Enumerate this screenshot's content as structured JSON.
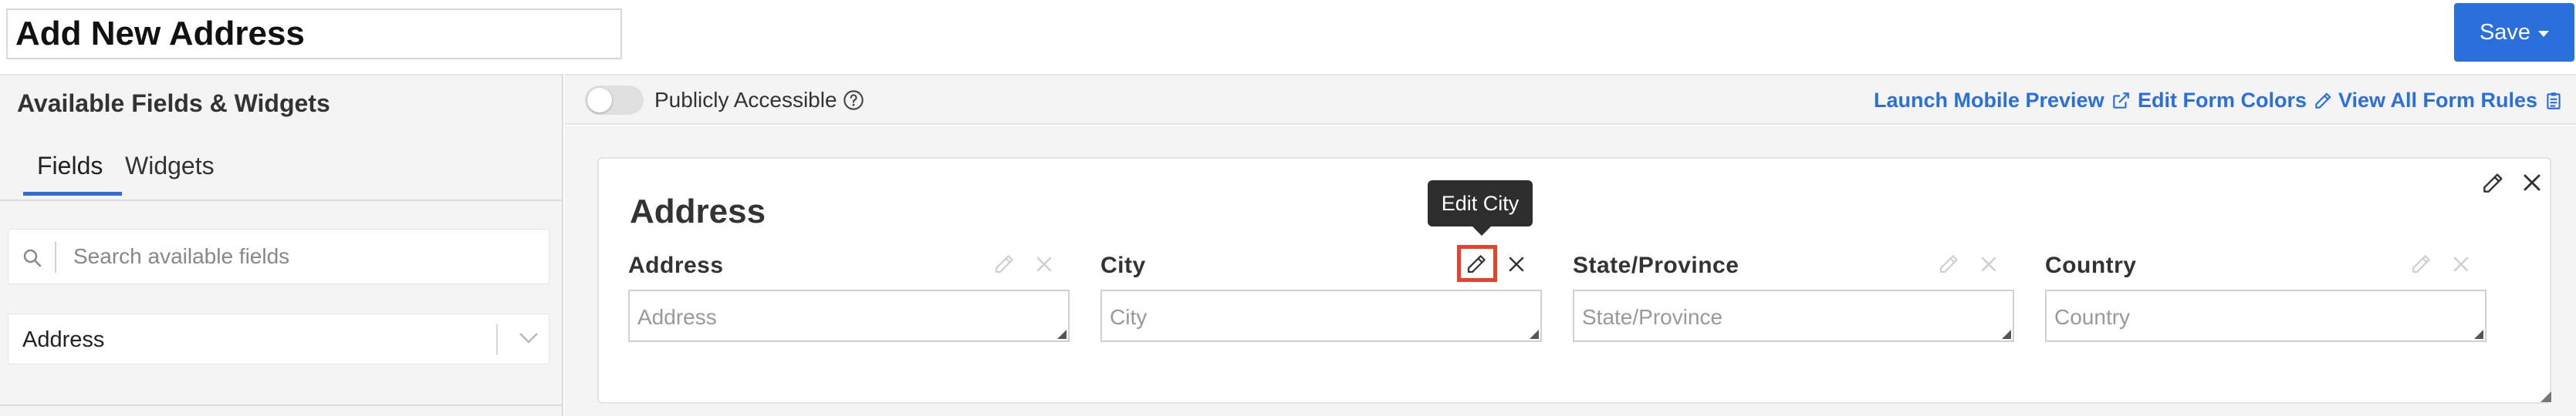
{
  "header": {
    "title": "Add New Address",
    "save_label": "Save"
  },
  "left_panel": {
    "title": "Available Fields & Widgets",
    "tabs": [
      {
        "label": "Fields",
        "active": true
      },
      {
        "label": "Widgets",
        "active": false
      }
    ],
    "search_placeholder": "Search available fields",
    "select_value": "Address"
  },
  "toolbar": {
    "publicly_accessible_label": "Publicly Accessible",
    "publicly_accessible_on": false,
    "links": {
      "mobile_preview": "Launch Mobile Preview",
      "form_colors": "Edit Form Colors",
      "form_rules": "View All Form Rules"
    }
  },
  "card": {
    "title": "Address",
    "fields": [
      {
        "label": "Address",
        "placeholder": "Address"
      },
      {
        "label": "City",
        "placeholder": "City"
      },
      {
        "label": "State/Province",
        "placeholder": "State/Province"
      },
      {
        "label": "Country",
        "placeholder": "Country"
      }
    ]
  },
  "tooltip": "Edit City",
  "colors": {
    "accent": "#2a6fdb",
    "highlight": "#e8412c",
    "panel_bg": "#f4f4f5"
  }
}
